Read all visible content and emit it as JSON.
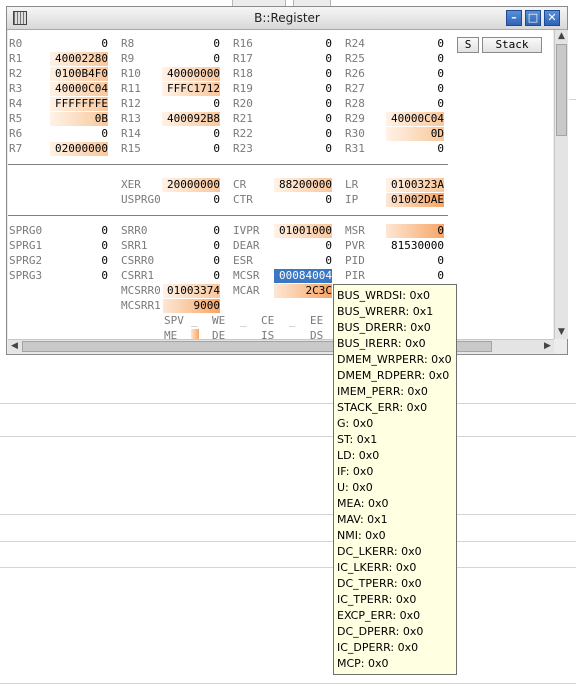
{
  "window": {
    "title": "B::Register"
  },
  "buttons": {
    "s": "S",
    "stack": "Stack"
  },
  "icons": {
    "minimize": "window-minimize-icon",
    "maximize": "window-maximize-icon",
    "close": "window-close-icon",
    "system": "window-menu-icon"
  },
  "gpr": {
    "r0": {
      "label": "R0",
      "value": "0"
    },
    "r1": {
      "label": "R1",
      "value": "40002280"
    },
    "r2": {
      "label": "R2",
      "value": "0100B4F0"
    },
    "r3": {
      "label": "R3",
      "value": "40000C04"
    },
    "r4": {
      "label": "R4",
      "value": "FFFFFFFE"
    },
    "r5": {
      "label": "R5",
      "value": "0B"
    },
    "r6": {
      "label": "R6",
      "value": "0"
    },
    "r7": {
      "label": "R7",
      "value": "02000000"
    },
    "r8": {
      "label": "R8",
      "value": "0"
    },
    "r9": {
      "label": "R9",
      "value": "0"
    },
    "r10": {
      "label": "R10",
      "value": "40000000"
    },
    "r11": {
      "label": "R11",
      "value": "FFFC1712"
    },
    "r12": {
      "label": "R12",
      "value": "0"
    },
    "r13": {
      "label": "R13",
      "value": "400092B8"
    },
    "r14": {
      "label": "R14",
      "value": "0"
    },
    "r15": {
      "label": "R15",
      "value": "0"
    },
    "r16": {
      "label": "R16",
      "value": "0"
    },
    "r17": {
      "label": "R17",
      "value": "0"
    },
    "r18": {
      "label": "R18",
      "value": "0"
    },
    "r19": {
      "label": "R19",
      "value": "0"
    },
    "r20": {
      "label": "R20",
      "value": "0"
    },
    "r21": {
      "label": "R21",
      "value": "0"
    },
    "r22": {
      "label": "R22",
      "value": "0"
    },
    "r23": {
      "label": "R23",
      "value": "0"
    },
    "r24": {
      "label": "R24",
      "value": "0"
    },
    "r25": {
      "label": "R25",
      "value": "0"
    },
    "r26": {
      "label": "R26",
      "value": "0"
    },
    "r27": {
      "label": "R27",
      "value": "0"
    },
    "r28": {
      "label": "R28",
      "value": "0"
    },
    "r29": {
      "label": "R29",
      "value": "40000C04"
    },
    "r30": {
      "label": "R30",
      "value": "0D"
    },
    "r31": {
      "label": "R31",
      "value": "0"
    }
  },
  "special": {
    "xer": {
      "label": "XER",
      "value": "20000000"
    },
    "usprg0": {
      "label": "USPRG0",
      "value": "0"
    },
    "cr": {
      "label": "CR",
      "value": "88200000"
    },
    "ctr": {
      "label": "CTR",
      "value": "0"
    },
    "lr": {
      "label": "LR",
      "value": "0100323A"
    },
    "ip": {
      "label": "IP",
      "value": "01002DAE"
    }
  },
  "sysreg": {
    "sprg0": {
      "label": "SPRG0",
      "value": "0"
    },
    "sprg1": {
      "label": "SPRG1",
      "value": "0"
    },
    "sprg2": {
      "label": "SPRG2",
      "value": "0"
    },
    "sprg3": {
      "label": "SPRG3",
      "value": "0"
    },
    "srr0": {
      "label": "SRR0",
      "value": "0"
    },
    "srr1": {
      "label": "SRR1",
      "value": "0"
    },
    "csrr0": {
      "label": "CSRR0",
      "value": "0"
    },
    "csrr1": {
      "label": "CSRR1",
      "value": "0"
    },
    "mcsrr0": {
      "label": "MCSRR0",
      "value": "01003374"
    },
    "mcsrr1": {
      "label": "MCSRR1",
      "value": "9000"
    },
    "ivpr": {
      "label": "IVPR",
      "value": "01001000"
    },
    "dear": {
      "label": "DEAR",
      "value": "0"
    },
    "esr": {
      "label": "ESR",
      "value": "0"
    },
    "mcsr": {
      "label": "MCSR",
      "value": "00084004"
    },
    "mcar": {
      "label": "MCAR",
      "value": "2C3C"
    },
    "msr": {
      "label": "MSR",
      "value": "0"
    },
    "pvr": {
      "label": "PVR",
      "value": "81530000"
    },
    "pid": {
      "label": "PID",
      "value": "0"
    },
    "pir": {
      "label": "PIR",
      "value": "0"
    }
  },
  "flags": {
    "spv": {
      "label": "SPV",
      "value": "_"
    },
    "we": {
      "label": "WE",
      "value": "_"
    },
    "ce": {
      "label": "CE",
      "value": "_"
    },
    "ee": {
      "label": "EE",
      "value": ""
    },
    "me": {
      "label": "ME",
      "value": ""
    },
    "de": {
      "label": "DE",
      "value": "_"
    },
    "is": {
      "label": "IS",
      "value": "_"
    },
    "ds": {
      "label": "DS",
      "value": ""
    }
  },
  "tooltip": {
    "lines": [
      "BUS_WRDSI: 0x0",
      "BUS_WRERR: 0x1",
      "BUS_DRERR: 0x0",
      "BUS_IRERR: 0x0",
      "DMEM_WRPERR: 0x0",
      "DMEM_RDPERR: 0x0",
      "IMEM_PERR: 0x0",
      "STACK_ERR: 0x0",
      "G: 0x0",
      "ST: 0x1",
      "LD: 0x0",
      "IF: 0x0",
      "U: 0x0",
      "MEA: 0x0",
      "MAV: 0x1",
      "NMI: 0x0",
      "DC_LKERR: 0x0",
      "IC_LKERR: 0x0",
      "DC_TPERR: 0x0",
      "IC_TPERR: 0x0",
      "EXCP_ERR: 0x0",
      "DC_DPERR: 0x0",
      "IC_DPERR: 0x0",
      "MCP: 0x0"
    ]
  }
}
